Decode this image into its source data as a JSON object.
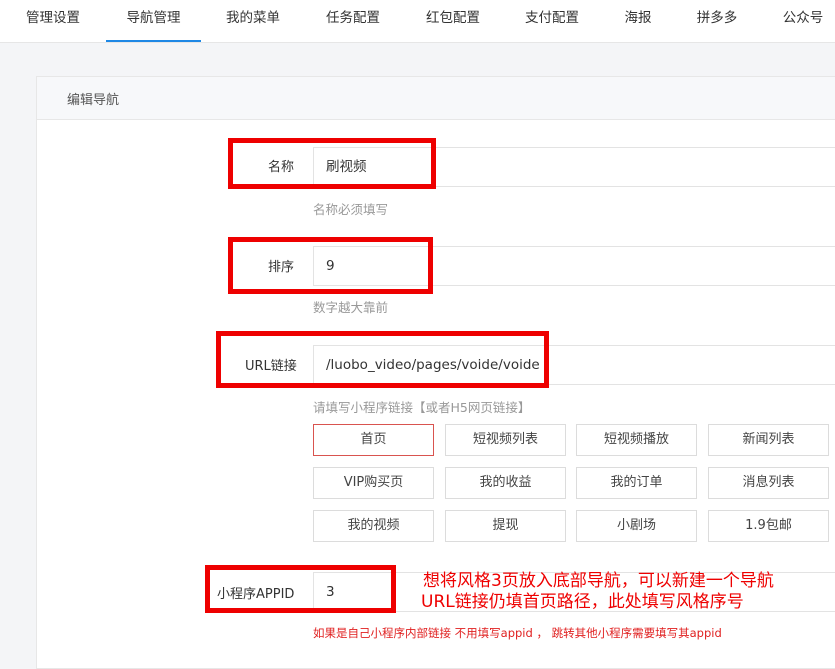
{
  "tabs": [
    {
      "label": "管理设置"
    },
    {
      "label": "导航管理",
      "active": true
    },
    {
      "label": "我的菜单"
    },
    {
      "label": "任务配置"
    },
    {
      "label": "红包配置"
    },
    {
      "label": "支付配置"
    },
    {
      "label": "海报"
    },
    {
      "label": "拼多多"
    },
    {
      "label": "公众号"
    }
  ],
  "card": {
    "title": "编辑导航"
  },
  "form": {
    "name": {
      "label": "名称",
      "value": "刷视频",
      "hint": "名称必须填写"
    },
    "sort": {
      "label": "排序",
      "value": "9",
      "hint": "数字越大靠前"
    },
    "url": {
      "label": "URL链接",
      "value": "/luobo_video/pages/voide/voide",
      "hint": "请填写小程序链接【或者H5网页链接】",
      "quick_links": [
        {
          "label": "首页",
          "selected": true
        },
        {
          "label": "短视频列表"
        },
        {
          "label": "短视频播放"
        },
        {
          "label": "新闻列表"
        },
        {
          "label": "VIP购买页"
        },
        {
          "label": "我的收益"
        },
        {
          "label": "我的订单"
        },
        {
          "label": "消息列表"
        },
        {
          "label": "我的视频"
        },
        {
          "label": "提现"
        },
        {
          "label": "小剧场"
        },
        {
          "label": "1.9包邮"
        }
      ]
    },
    "appid": {
      "label": "小程序APPID",
      "value": "3",
      "hint": "如果是自己小程序内部链接 不用填写appid ， 跳转其他小程序需要填写其appid"
    }
  },
  "annotation": {
    "line1": "想将风格3页放入底部导航，可以新建一个导航",
    "line2": "URL链接仍填首页路径，此处填写风格序号"
  },
  "colors": {
    "accent": "#1e88e5",
    "highlight": "#ee0000"
  }
}
